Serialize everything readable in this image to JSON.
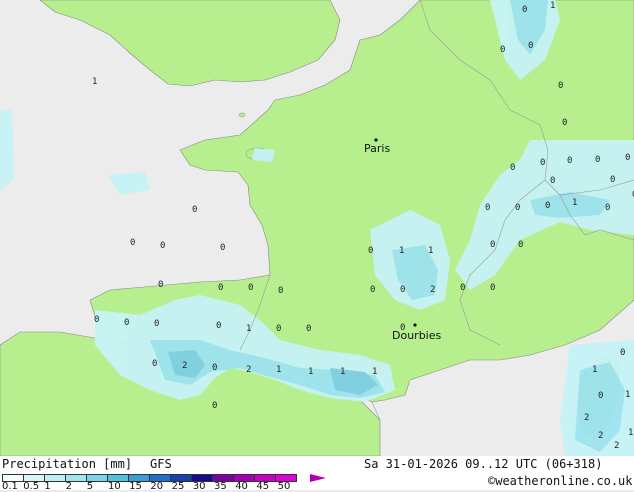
{
  "map": {
    "cities": [
      {
        "name": "Paris"
      },
      {
        "name": "Dourbies"
      }
    ],
    "precip_labels": [
      "0",
      "1",
      "0",
      "0",
      "1",
      "0",
      "0",
      "0",
      "0",
      "0",
      "0",
      "0",
      "0",
      "0",
      "1",
      "0",
      "0",
      "0",
      "0",
      "0",
      "0",
      "0",
      "0",
      "0",
      "0",
      "0",
      "0",
      "0",
      "0",
      "0",
      "0",
      "1",
      "1",
      "0",
      "0",
      "2",
      "0",
      "0",
      "0",
      "0",
      "0",
      "0",
      "0",
      "1",
      "0",
      "0",
      "0",
      "0",
      "2",
      "0",
      "2",
      "1",
      "1",
      "1",
      "1",
      "1",
      "0",
      "0",
      "1",
      "2",
      "1",
      "2",
      "2"
    ]
  },
  "footer": {
    "title": "Precipitation [mm]",
    "model": "GFS",
    "valid_time": "Sa 31-01-2026 09..12 UTC (06+318)",
    "credit": "©weatheronline.co.uk"
  },
  "legend": {
    "ticks": [
      "0.1",
      "0.5",
      "1",
      "2",
      "5",
      "10",
      "15",
      "20",
      "25",
      "30",
      "35",
      "40",
      "45",
      "50"
    ],
    "colors": [
      "#f5fdfd",
      "#d8f4f7",
      "#bdeef4",
      "#9ee6f0",
      "#79d6e8",
      "#55bfe0",
      "#3a9ed6",
      "#2270c8",
      "#1a3fae",
      "#1a0a8f",
      "#7a00a8",
      "#a300b8",
      "#c800c8",
      "#e000d8"
    ]
  },
  "colors": {
    "land": "#b7ee8e",
    "sea": "#ececec",
    "precip_light": "#c6f3f7",
    "precip_mid": "#9ee3ef",
    "precip_heavy": "#7fcfe4"
  }
}
